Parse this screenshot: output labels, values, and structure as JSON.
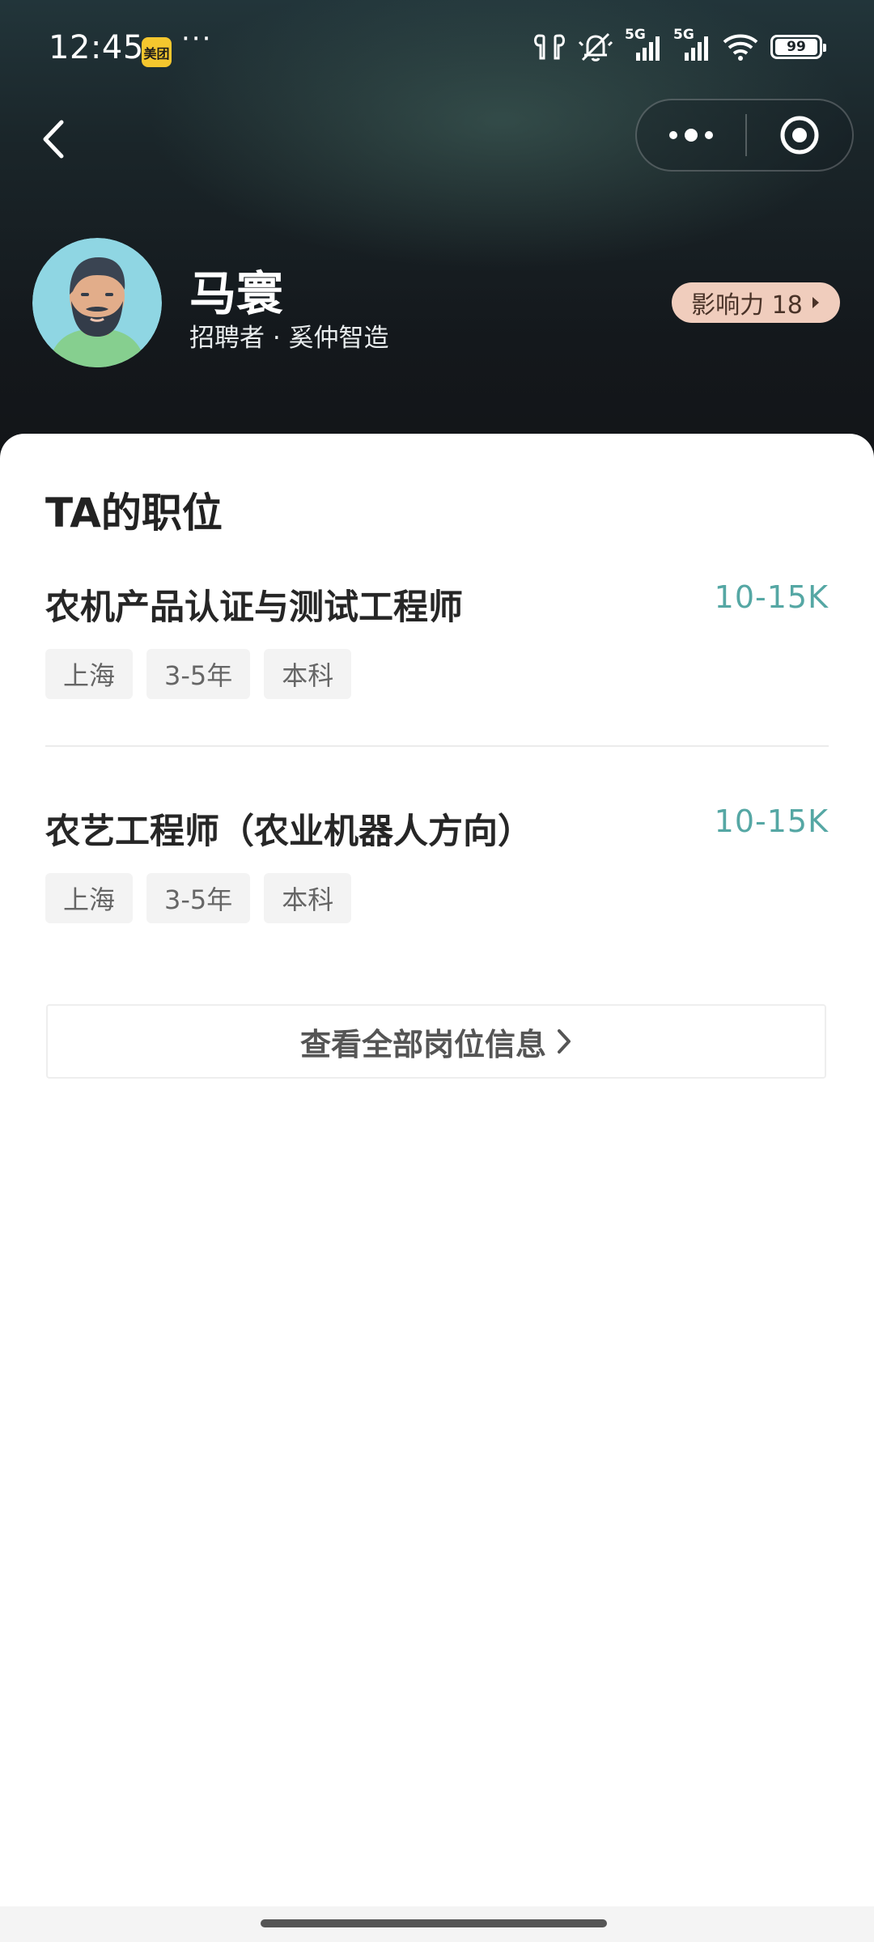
{
  "status_bar": {
    "time": "12:45",
    "app_badge": "美团",
    "more_indicator": "···",
    "network_1": "5G",
    "network_2": "5G",
    "battery": "99"
  },
  "profile": {
    "name": "马寰",
    "subtitle": "招聘者 · 奚仲智造",
    "influence_label": "影响力 18"
  },
  "section": {
    "title": "TA的职位"
  },
  "jobs": [
    {
      "title": "农机产品认证与测试工程师",
      "salary": "10-15K",
      "tags": [
        "上海",
        "3-5年",
        "本科"
      ]
    },
    {
      "title": "农艺工程师（农业机器人方向）",
      "salary": "10-15K",
      "tags": [
        "上海",
        "3-5年",
        "本科"
      ]
    }
  ],
  "view_all_label": "查看全部岗位信息",
  "colors": {
    "salary": "#55a7a4",
    "influence_bg": "#f0cdbd",
    "header_dark": "#14181c"
  }
}
